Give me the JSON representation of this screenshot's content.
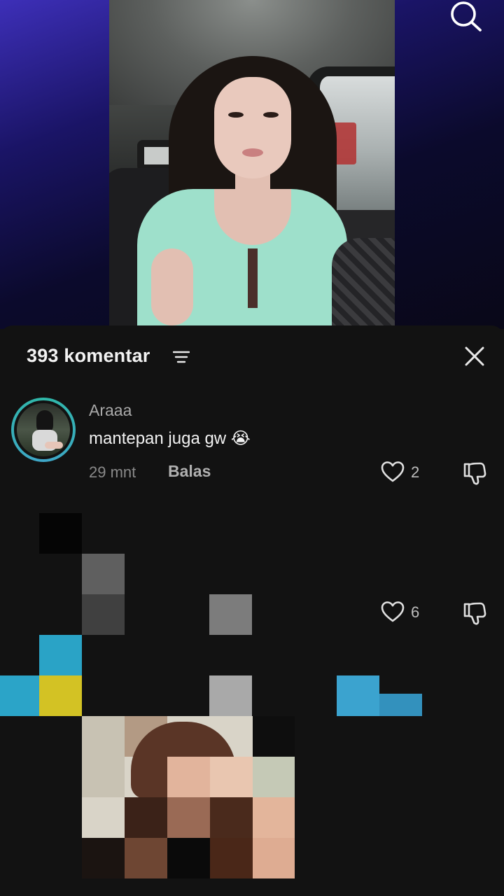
{
  "search": {
    "icon": "search-icon"
  },
  "sheet": {
    "count_label": "393 komentar",
    "filter_icon": "filter-icon",
    "close_icon": "close-icon"
  },
  "comments": [
    {
      "username": "Araaa",
      "text": "mantepan juga gw 😭",
      "time": "29 mnt",
      "reply_label": "Balas",
      "likes": "2"
    },
    {
      "likes": "6"
    }
  ],
  "colors": {
    "background": "#121212",
    "avatar_ring": "#2fb8a8",
    "text_primary": "#f2f2f2",
    "text_secondary": "#8a8a8a"
  }
}
